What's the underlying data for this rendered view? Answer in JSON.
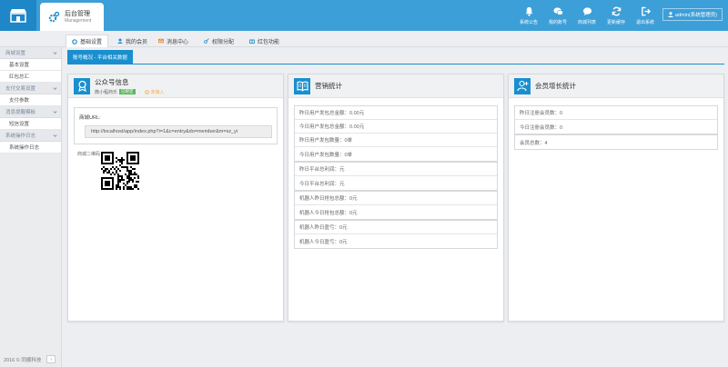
{
  "header": {
    "title": "后台管理",
    "subtitle": "Management",
    "nav": [
      {
        "label": "系统公告",
        "icon": "bell-icon"
      },
      {
        "label": "我的账号",
        "icon": "chat-icon"
      },
      {
        "label": "商城列表",
        "icon": "message-icon"
      },
      {
        "label": "更新缓存",
        "icon": "refresh-icon"
      },
      {
        "label": "退出系统",
        "icon": "logout-icon"
      }
    ],
    "user": "admin(系统管理员)"
  },
  "tabs": [
    {
      "label": "基础设置",
      "icon": "gear-icon",
      "active": true
    },
    {
      "label": "我的会员",
      "icon": "user-icon",
      "active": false
    },
    {
      "label": "消息中心",
      "icon": "mail-icon",
      "active": false
    },
    {
      "label": "权限分配",
      "icon": "key-icon",
      "active": false
    },
    {
      "label": "红包功能",
      "icon": "gift-icon",
      "active": false
    }
  ],
  "sidebar": {
    "groups": [
      {
        "label": "商城设置",
        "items": [
          "基本设置",
          "红包总汇"
        ]
      },
      {
        "label": "支付交易设置",
        "items": [
          "支付参数"
        ]
      },
      {
        "label": "消息提醒模板",
        "items": [
          "短信设置"
        ]
      },
      {
        "label": "系统操作日志",
        "items": [
          "系统操作日志"
        ]
      }
    ],
    "footer": "2016 © 同顺科技",
    "collapse": "‹"
  },
  "section_tab": "账号概况 - 平台相关数据",
  "card1": {
    "title": "公众号信息",
    "account_name": "微小程商乐",
    "badge": "已绑定",
    "pending": "未接入",
    "url_label": "商城URL:",
    "url_value": "http://localhost/app/index.php?i=1&c=entry&do=member&m=sz_yi",
    "qr_label": "商城二维码"
  },
  "card2": {
    "title": "营销统计",
    "groups": [
      [
        "昨日用户发包总金额：0.00元",
        "今日用户发包总金额：0.00元",
        "昨日用户发包数量：0单",
        "今日用户发包数量：0单"
      ],
      [
        "昨日平台总利润：元",
        "今日平台总利润：元"
      ],
      [
        "机器人昨日抢包总额：0元",
        "机器人今日抢包总额：0元"
      ],
      [
        "机器人昨日盈亏：0元",
        "机器人今日盈亏：0元"
      ]
    ]
  },
  "card3": {
    "title": "会员增长统计",
    "groups": [
      [
        "昨日注册会员数：0",
        "今日注册会员数：0"
      ],
      [
        "会员总数：4"
      ]
    ]
  },
  "colors": {
    "primary": "#1a8fcf",
    "header": "#3c9fd8",
    "badge": "#5cb85c",
    "pending": "#f0ad4e"
  }
}
